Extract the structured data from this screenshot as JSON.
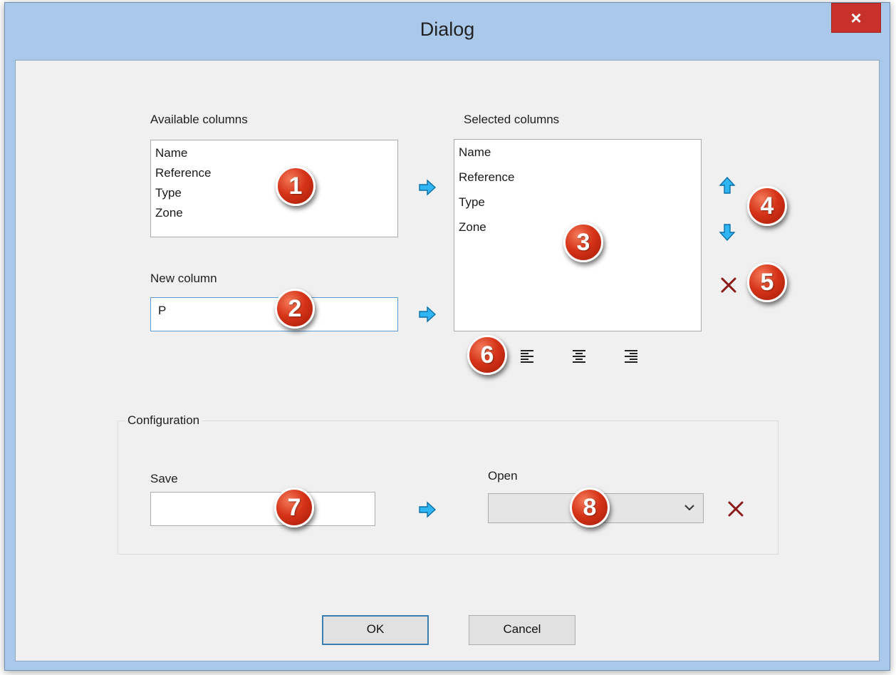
{
  "window": {
    "title": "Dialog",
    "close_label": "×"
  },
  "available": {
    "label": "Available columns",
    "items": [
      "Name",
      "Reference",
      "Type",
      "Zone"
    ]
  },
  "selected": {
    "label": "Selected columns",
    "items": [
      "Name",
      "Reference",
      "Type",
      "Zone"
    ]
  },
  "new_column": {
    "label": "New column",
    "value": "P"
  },
  "configuration": {
    "group_label": "Configuration",
    "save_label": "Save",
    "save_value": "",
    "open_label": "Open",
    "open_value": ""
  },
  "buttons": {
    "ok": "OK",
    "cancel": "Cancel"
  },
  "callouts": [
    "1",
    "2",
    "3",
    "4",
    "5",
    "6",
    "7",
    "8"
  ],
  "colors": {
    "arrow": "#2fb6f2",
    "delete": "#8b1a1a",
    "callout": "#d63418",
    "title_bar": "#a9c8ea",
    "close_button": "#c7312a"
  }
}
